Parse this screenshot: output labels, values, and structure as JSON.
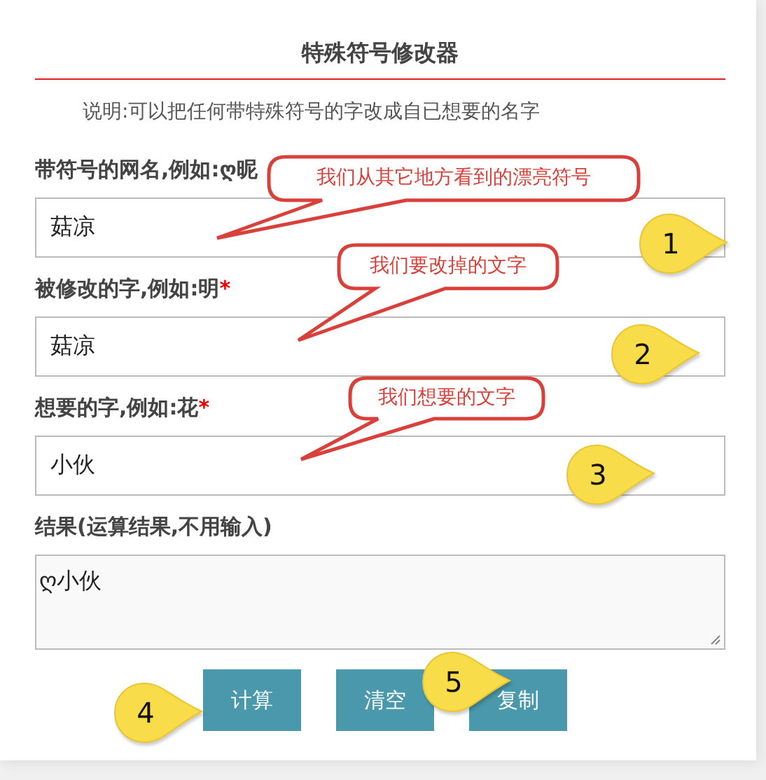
{
  "title": "特殊符号修改器",
  "description": "说明:可以把任何带特殊符号的字改成自已想要的名字",
  "fields": [
    {
      "kind": "input",
      "label": "带符号的网名,例如:ღ昵",
      "value": "菇凉"
    },
    {
      "kind": "input",
      "label": "被修改的字,例如:明",
      "required_mark": "*",
      "value": "菇凉"
    },
    {
      "kind": "input",
      "label": "想要的字,例如:花",
      "required_mark": "*",
      "value": "小伙"
    },
    {
      "kind": "textarea",
      "label": "结果(运算结果,不用输入)",
      "value": "ღ小伙"
    }
  ],
  "buttons": [
    "计算",
    "清空",
    "复制"
  ],
  "callouts": [
    {
      "text": "我们从其它地方看到的漂亮符号"
    },
    {
      "text": "我们要改掉的文字"
    },
    {
      "text": "我们想要的文字"
    }
  ],
  "markers": [
    {
      "number": "1"
    },
    {
      "number": "2"
    },
    {
      "number": "3"
    },
    {
      "number": "4"
    },
    {
      "number": "5"
    }
  ]
}
